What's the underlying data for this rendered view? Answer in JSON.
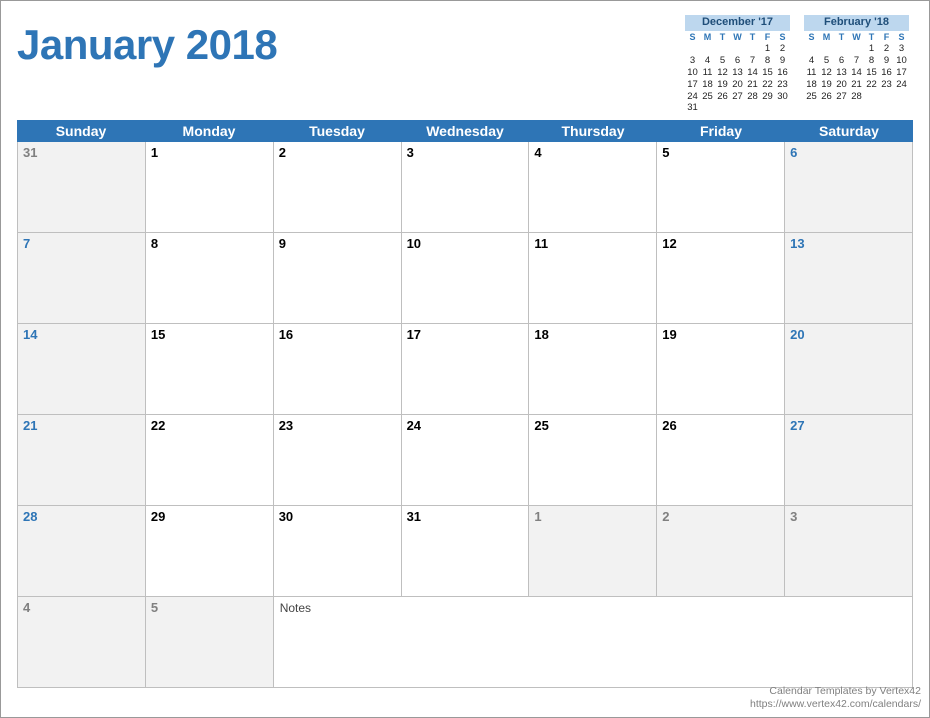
{
  "title": "January 2018",
  "dow": [
    "Sunday",
    "Monday",
    "Tuesday",
    "Wednesday",
    "Thursday",
    "Friday",
    "Saturday"
  ],
  "mini_dow": [
    "S",
    "M",
    "T",
    "W",
    "T",
    "F",
    "S"
  ],
  "mini_prev": {
    "title": "December '17",
    "cells": [
      "",
      "",
      "",
      "",
      "",
      "1",
      "2",
      "3",
      "4",
      "5",
      "6",
      "7",
      "8",
      "9",
      "10",
      "11",
      "12",
      "13",
      "14",
      "15",
      "16",
      "17",
      "18",
      "19",
      "20",
      "21",
      "22",
      "23",
      "24",
      "25",
      "26",
      "27",
      "28",
      "29",
      "30",
      "31",
      "",
      "",
      "",
      "",
      "",
      ""
    ]
  },
  "mini_next": {
    "title": "February '18",
    "cells": [
      "",
      "",
      "",
      "",
      "1",
      "2",
      "3",
      "4",
      "5",
      "6",
      "7",
      "8",
      "9",
      "10",
      "11",
      "12",
      "13",
      "14",
      "15",
      "16",
      "17",
      "18",
      "19",
      "20",
      "21",
      "22",
      "23",
      "24",
      "25",
      "26",
      "27",
      "28",
      "",
      "",
      "",
      "",
      "",
      "",
      "",
      "",
      "",
      ""
    ]
  },
  "grid": [
    [
      {
        "n": "31",
        "shade": true,
        "cls": "grey"
      },
      {
        "n": "1"
      },
      {
        "n": "2"
      },
      {
        "n": "3"
      },
      {
        "n": "4"
      },
      {
        "n": "5"
      },
      {
        "n": "6",
        "shade": true,
        "cls": "blue"
      }
    ],
    [
      {
        "n": "7",
        "shade": true,
        "cls": "blue"
      },
      {
        "n": "8"
      },
      {
        "n": "9"
      },
      {
        "n": "10"
      },
      {
        "n": "11"
      },
      {
        "n": "12"
      },
      {
        "n": "13",
        "shade": true,
        "cls": "blue"
      }
    ],
    [
      {
        "n": "14",
        "shade": true,
        "cls": "blue"
      },
      {
        "n": "15"
      },
      {
        "n": "16"
      },
      {
        "n": "17"
      },
      {
        "n": "18"
      },
      {
        "n": "19"
      },
      {
        "n": "20",
        "shade": true,
        "cls": "blue"
      }
    ],
    [
      {
        "n": "21",
        "shade": true,
        "cls": "blue"
      },
      {
        "n": "22"
      },
      {
        "n": "23"
      },
      {
        "n": "24"
      },
      {
        "n": "25"
      },
      {
        "n": "26"
      },
      {
        "n": "27",
        "shade": true,
        "cls": "blue"
      }
    ],
    [
      {
        "n": "28",
        "shade": true,
        "cls": "blue"
      },
      {
        "n": "29"
      },
      {
        "n": "30"
      },
      {
        "n": "31"
      },
      {
        "n": "1",
        "shade": true,
        "cls": "grey"
      },
      {
        "n": "2",
        "shade": true,
        "cls": "grey"
      },
      {
        "n": "3",
        "shade": true,
        "cls": "grey"
      }
    ]
  ],
  "last_row": [
    {
      "n": "4",
      "shade": true,
      "cls": "grey"
    },
    {
      "n": "5",
      "shade": true,
      "cls": "grey"
    }
  ],
  "notes_label": "Notes",
  "footer": {
    "line1": "Calendar Templates by Vertex42",
    "line2": "https://www.vertex42.com/calendars/"
  }
}
